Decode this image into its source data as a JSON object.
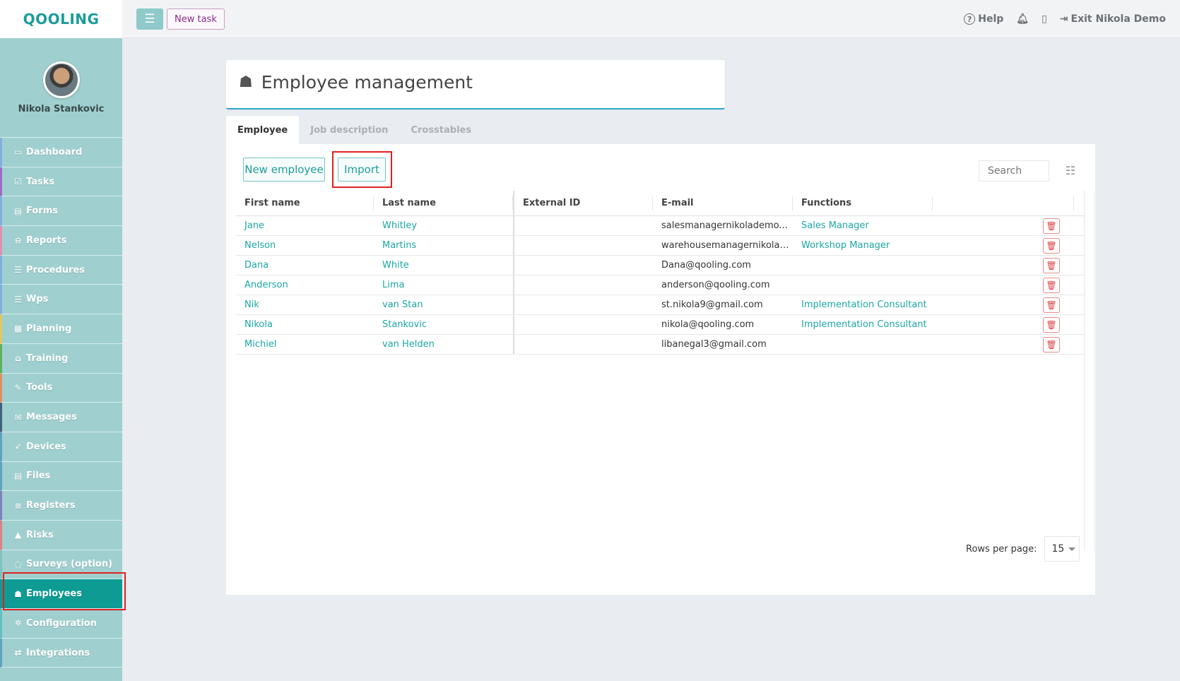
{
  "app": {
    "logo": "QOOLING",
    "user_name": "Nikola Stankovic"
  },
  "sidebar": {
    "items": [
      {
        "label": "Dashboard",
        "icon": "monitor-icon",
        "glyph": "▭"
      },
      {
        "label": "Tasks",
        "icon": "check-square-icon",
        "glyph": "☑"
      },
      {
        "label": "Forms",
        "icon": "file-icon",
        "glyph": "▤"
      },
      {
        "label": "Reports",
        "icon": "bell-icon",
        "glyph": "⍾"
      },
      {
        "label": "Procedures",
        "icon": "list-icon",
        "glyph": "☰"
      },
      {
        "label": "Wps",
        "icon": "list-alt-icon",
        "glyph": "☰"
      },
      {
        "label": "Planning",
        "icon": "calendar-icon",
        "glyph": "▦"
      },
      {
        "label": "Training",
        "icon": "graduation-cap-icon",
        "glyph": "⌂"
      },
      {
        "label": "Tools",
        "icon": "wrench-icon",
        "glyph": "✎"
      },
      {
        "label": "Messages",
        "icon": "envelope-icon",
        "glyph": "✉"
      },
      {
        "label": "Devices",
        "icon": "rocket-icon",
        "glyph": "➶"
      },
      {
        "label": "Files",
        "icon": "file-pdf-icon",
        "glyph": "▤"
      },
      {
        "label": "Registers",
        "icon": "list-icon",
        "glyph": "≡"
      },
      {
        "label": "Risks",
        "icon": "warning-icon",
        "glyph": "▲"
      },
      {
        "label": "Surveys (option)",
        "icon": "comment-icon",
        "glyph": "◌"
      },
      {
        "label": "Employees",
        "icon": "users-icon",
        "glyph": "☗"
      },
      {
        "label": "Configuration",
        "icon": "gear-icon",
        "glyph": "✲"
      },
      {
        "label": "Integrations",
        "icon": "exchange-icon",
        "glyph": "⇄"
      }
    ],
    "active": "Employees"
  },
  "topbar": {
    "new_task_label": "New task",
    "help_label": "Help",
    "exit_label": "Exit Nikola Demo"
  },
  "header": {
    "title": "Employee management"
  },
  "tabs": [
    {
      "label": "Employee",
      "active": true
    },
    {
      "label": "Job description",
      "active": false
    },
    {
      "label": "Crosstables",
      "active": false
    }
  ],
  "toolbar": {
    "new_employee_label": "New employee",
    "import_label": "Import",
    "search_placeholder": "Search"
  },
  "table": {
    "columns": [
      "First name",
      "Last name",
      "External ID",
      "E-mail",
      "Functions"
    ],
    "rows": [
      {
        "first": "Jane",
        "last": "Whitley",
        "external_id": "",
        "email": "salesmanagernikolademo...",
        "functions": "Sales Manager"
      },
      {
        "first": "Nelson",
        "last": "Martins",
        "external_id": "",
        "email": "warehousemanagernikolad...",
        "functions": "Workshop Manager"
      },
      {
        "first": "Dana",
        "last": "White",
        "external_id": "",
        "email": "Dana@qooling.com",
        "functions": ""
      },
      {
        "first": "Anderson",
        "last": "Lima",
        "external_id": "",
        "email": "anderson@qooling.com",
        "functions": ""
      },
      {
        "first": "Nik",
        "last": "van Stan",
        "external_id": "",
        "email": "st.nikola9@gmail.com",
        "functions": "Implementation Consultant"
      },
      {
        "first": "Nikola",
        "last": "Stankovic",
        "external_id": "",
        "email": "nikola@qooling.com",
        "functions": "Implementation Consultant"
      },
      {
        "first": "Michiel",
        "last": "van Helden",
        "external_id": "",
        "email": "libanegal3@gmail.com",
        "functions": ""
      }
    ]
  },
  "pagination": {
    "rows_per_page_label": "Rows per page:",
    "rows_per_page_value": "15"
  },
  "colors": {
    "accent": "#1ba7a5",
    "sidebar": "#a0cfcf",
    "active_nav": "#0e9b93",
    "highlight": "#e02020"
  }
}
